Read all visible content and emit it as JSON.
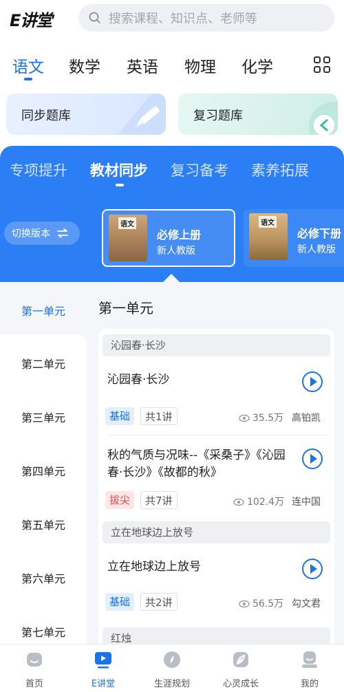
{
  "app": {
    "logo": "E讲堂"
  },
  "search": {
    "placeholder": "搜索课程、知识点、老师等"
  },
  "subjects": [
    "语文",
    "数学",
    "英语",
    "物理",
    "化学"
  ],
  "banks": {
    "sync": "同步题库",
    "review": "复习题库"
  },
  "categories": [
    "专项提升",
    "教材同步",
    "复习备考",
    "素养拓展"
  ],
  "switch_version": "切换版本",
  "books": [
    {
      "title": "必修上册",
      "edition": "新人教版",
      "cover_text": "语文"
    },
    {
      "title": "必修下册",
      "edition": "新人教版",
      "cover_text": "语文"
    }
  ],
  "units": [
    "第一单元",
    "第二单元",
    "第三单元",
    "第四单元",
    "第五单元",
    "第六单元",
    "第七单元"
  ],
  "section": {
    "title": "第一单元"
  },
  "groups": [
    {
      "header": "沁园春·长沙"
    },
    {
      "header": "立在地球边上放号"
    },
    {
      "header": "红烛"
    }
  ],
  "lessons": [
    {
      "title": "沁园春·长沙",
      "level": "基础",
      "count": "共1讲",
      "views": "35.5万",
      "teacher": "高铂凯"
    },
    {
      "title": "秋的气质与况味--《采桑子》《沁园春·长沙》《故都的秋》",
      "level": "拔尖",
      "count": "共7讲",
      "views": "102.4万",
      "teacher": "连中国"
    },
    {
      "title": "立在地球边上放号",
      "level": "基础",
      "count": "共2讲",
      "views": "56.5万",
      "teacher": "勾文君"
    }
  ],
  "nav": [
    "首页",
    "E讲堂",
    "生涯规划",
    "心灵成长",
    "我的"
  ],
  "colors": {
    "accent": "#1a73e8",
    "panel": "#2c7ef4",
    "hard": "#e24a4a"
  }
}
